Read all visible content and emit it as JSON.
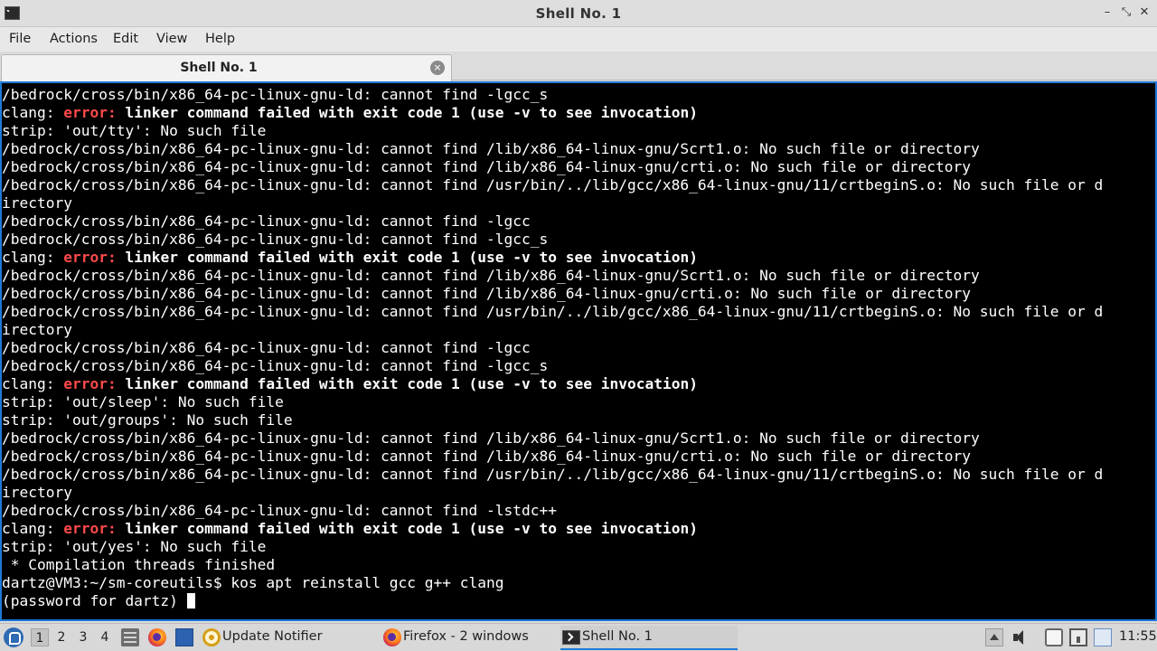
{
  "window": {
    "title": "Shell No. 1",
    "controls": {
      "minimize": "–",
      "maximize": "⤡",
      "close": "✕"
    }
  },
  "menu": [
    "File",
    "Actions",
    "Edit",
    "View",
    "Help"
  ],
  "tab": {
    "label": "Shell No. 1",
    "close": "×"
  },
  "terminal": {
    "lines": [
      {
        "segments": [
          {
            "t": "/bedrock/cross/bin/x86_64-pc-linux-gnu-ld: cannot find -lgcc_s"
          }
        ]
      },
      {
        "segments": [
          {
            "t": "clang: "
          },
          {
            "t": "error:",
            "s": "err"
          },
          {
            "t": " linker command failed with exit code 1 (use -v to see invocation)",
            "s": "bold"
          }
        ]
      },
      {
        "segments": [
          {
            "t": "strip: 'out/tty': No such file"
          }
        ]
      },
      {
        "segments": [
          {
            "t": "/bedrock/cross/bin/x86_64-pc-linux-gnu-ld: cannot find /lib/x86_64-linux-gnu/Scrt1.o: No such file or directory"
          }
        ]
      },
      {
        "segments": [
          {
            "t": "/bedrock/cross/bin/x86_64-pc-linux-gnu-ld: cannot find /lib/x86_64-linux-gnu/crti.o: No such file or directory"
          }
        ]
      },
      {
        "segments": [
          {
            "t": "/bedrock/cross/bin/x86_64-pc-linux-gnu-ld: cannot find /usr/bin/../lib/gcc/x86_64-linux-gnu/11/crtbeginS.o: No such file or d"
          }
        ]
      },
      {
        "segments": [
          {
            "t": "irectory"
          }
        ]
      },
      {
        "segments": [
          {
            "t": "/bedrock/cross/bin/x86_64-pc-linux-gnu-ld: cannot find -lgcc"
          }
        ]
      },
      {
        "segments": [
          {
            "t": "/bedrock/cross/bin/x86_64-pc-linux-gnu-ld: cannot find -lgcc_s"
          }
        ]
      },
      {
        "segments": [
          {
            "t": "clang: "
          },
          {
            "t": "error:",
            "s": "err"
          },
          {
            "t": " linker command failed with exit code 1 (use -v to see invocation)",
            "s": "bold"
          }
        ]
      },
      {
        "segments": [
          {
            "t": "/bedrock/cross/bin/x86_64-pc-linux-gnu-ld: cannot find /lib/x86_64-linux-gnu/Scrt1.o: No such file or directory"
          }
        ]
      },
      {
        "segments": [
          {
            "t": "/bedrock/cross/bin/x86_64-pc-linux-gnu-ld: cannot find /lib/x86_64-linux-gnu/crti.o: No such file or directory"
          }
        ]
      },
      {
        "segments": [
          {
            "t": "/bedrock/cross/bin/x86_64-pc-linux-gnu-ld: cannot find /usr/bin/../lib/gcc/x86_64-linux-gnu/11/crtbeginS.o: No such file or d"
          }
        ]
      },
      {
        "segments": [
          {
            "t": "irectory"
          }
        ]
      },
      {
        "segments": [
          {
            "t": "/bedrock/cross/bin/x86_64-pc-linux-gnu-ld: cannot find -lgcc"
          }
        ]
      },
      {
        "segments": [
          {
            "t": "/bedrock/cross/bin/x86_64-pc-linux-gnu-ld: cannot find -lgcc_s"
          }
        ]
      },
      {
        "segments": [
          {
            "t": "clang: "
          },
          {
            "t": "error:",
            "s": "err"
          },
          {
            "t": " linker command failed with exit code 1 (use -v to see invocation)",
            "s": "bold"
          }
        ]
      },
      {
        "segments": [
          {
            "t": "strip: 'out/sleep': No such file"
          }
        ]
      },
      {
        "segments": [
          {
            "t": "strip: 'out/groups': No such file"
          }
        ]
      },
      {
        "segments": [
          {
            "t": "/bedrock/cross/bin/x86_64-pc-linux-gnu-ld: cannot find /lib/x86_64-linux-gnu/Scrt1.o: No such file or directory"
          }
        ]
      },
      {
        "segments": [
          {
            "t": "/bedrock/cross/bin/x86_64-pc-linux-gnu-ld: cannot find /lib/x86_64-linux-gnu/crti.o: No such file or directory"
          }
        ]
      },
      {
        "segments": [
          {
            "t": "/bedrock/cross/bin/x86_64-pc-linux-gnu-ld: cannot find /usr/bin/../lib/gcc/x86_64-linux-gnu/11/crtbeginS.o: No such file or d"
          }
        ]
      },
      {
        "segments": [
          {
            "t": "irectory"
          }
        ]
      },
      {
        "segments": [
          {
            "t": "/bedrock/cross/bin/x86_64-pc-linux-gnu-ld: cannot find -lstdc++"
          }
        ]
      },
      {
        "segments": [
          {
            "t": "clang: "
          },
          {
            "t": "error:",
            "s": "err"
          },
          {
            "t": " linker command failed with exit code 1 (use -v to see invocation)",
            "s": "bold"
          }
        ]
      },
      {
        "segments": [
          {
            "t": "strip: 'out/yes': No such file"
          }
        ]
      },
      {
        "segments": [
          {
            "t": " * Compilation threads finished"
          }
        ]
      },
      {
        "segments": [
          {
            "t": "dartz@VM3:~/sm-coreutils$ kos apt reinstall gcc g++ clang"
          }
        ]
      },
      {
        "segments": [
          {
            "t": "(password for dartz) "
          }
        ],
        "cursor": true
      }
    ],
    "colors": {
      "background": "#000000",
      "text": "#ffffff",
      "error": "#ff4a4a",
      "focus_border": "#1c7ad8"
    }
  },
  "taskbar": {
    "workspaces": [
      "1",
      "2",
      "3",
      "4"
    ],
    "active_workspace": "1",
    "quick_launch": [
      "files-icon",
      "firefox-icon",
      "show-desktop-icon"
    ],
    "tasks": [
      {
        "label": "Update Notifier",
        "icon": "update-notifier-icon"
      },
      {
        "label": "Firefox - 2 windows",
        "icon": "firefox-icon"
      },
      {
        "label": "Shell No. 1",
        "icon": "terminal-icon",
        "active": true
      }
    ],
    "tray": [
      "tray-expand-icon",
      "volume-icon",
      "clipboard-icon",
      "network-icon",
      "update-icon"
    ],
    "clock": "11:55"
  }
}
